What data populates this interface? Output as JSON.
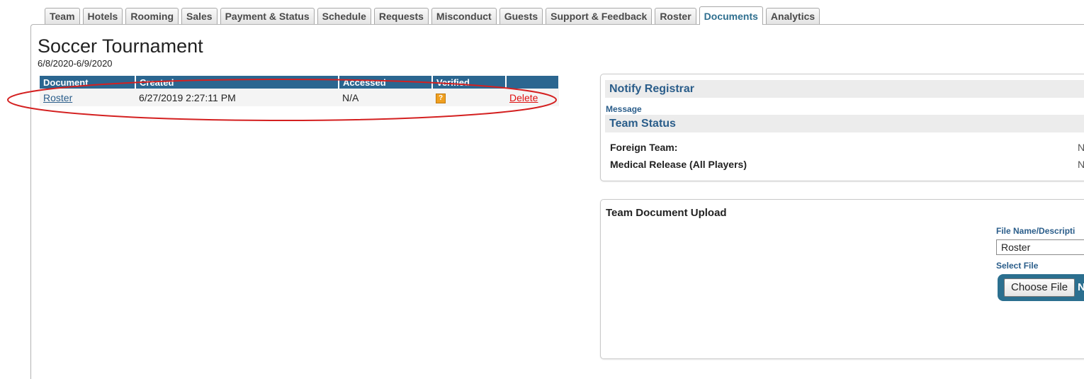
{
  "tabs": [
    "Team",
    "Hotels",
    "Rooming",
    "Sales",
    "Payment & Status",
    "Schedule",
    "Requests",
    "Misconduct",
    "Guests",
    "Support & Feedback",
    "Roster",
    "Documents",
    "Analytics"
  ],
  "active_tab": "Documents",
  "event": {
    "title": "Soccer Tournament",
    "dates": "6/8/2020-6/9/2020"
  },
  "documents_table": {
    "headers": [
      "Document",
      "Created",
      "Accessed",
      "Verified",
      ""
    ],
    "rows": [
      {
        "document": "Roster",
        "created": "6/27/2019 2:27:11 PM",
        "accessed": "N/A",
        "verified_icon": "?",
        "action": "Delete"
      }
    ]
  },
  "notify": {
    "header": "Notify Registrar",
    "message_label": "Message"
  },
  "team_status": {
    "header": "Team Status",
    "items": [
      {
        "label": "Foreign Team:",
        "value": "N"
      },
      {
        "label": "Medical Release (All Players)",
        "value": "N"
      }
    ]
  },
  "upload": {
    "title": "Team Document Upload",
    "file_name_label": "File Name/Descripti",
    "file_name_value": "Roster",
    "select_file_label": "Select File",
    "choose_file_button": "Choose File",
    "no_file_text": "N"
  },
  "colors": {
    "accent": "#2b6690",
    "annotation": "#d42020",
    "delete": "#e01010",
    "verified_icon": "#f0a020"
  }
}
